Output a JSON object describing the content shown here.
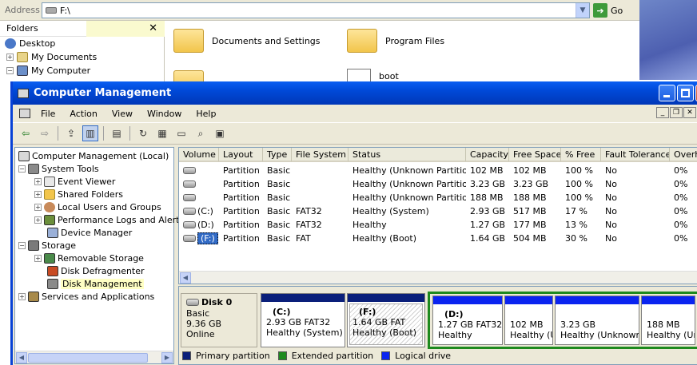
{
  "explorer": {
    "address_label": "Address",
    "address_value": "F:\\",
    "go_label": "Go",
    "folders_title": "Folders",
    "tree": [
      "Desktop",
      "My Documents",
      "My Computer"
    ],
    "files": [
      "Documents and Settings",
      "Program Files",
      "boot"
    ]
  },
  "window": {
    "title": "Computer Management",
    "menu": [
      "File",
      "Action",
      "View",
      "Window",
      "Help"
    ]
  },
  "tree": {
    "root": "Computer Management (Local)",
    "system_tools": "System Tools",
    "event_viewer": "Event Viewer",
    "shared_folders": "Shared Folders",
    "local_users": "Local Users and Groups",
    "perf_logs": "Performance Logs and Alerts",
    "device_manager": "Device Manager",
    "storage": "Storage",
    "removable_storage": "Removable Storage",
    "disk_defrag": "Disk Defragmenter",
    "disk_management": "Disk Management",
    "services_apps": "Services and Applications"
  },
  "volumes": {
    "columns": [
      "Volume",
      "Layout",
      "Type",
      "File System",
      "Status",
      "Capacity",
      "Free Space",
      "% Free",
      "Fault Tolerance",
      "Overhead"
    ],
    "columns_visible": [
      "Volume",
      "Layout",
      "Type",
      "File System",
      "Status",
      "Capacity",
      "Free Space",
      "% Free",
      "Fault Tolerance",
      "Overhe"
    ],
    "rows": [
      [
        "",
        "Partition",
        "Basic",
        "",
        "Healthy (Unknown Partition)",
        "102 MB",
        "102 MB",
        "100 %",
        "No",
        "0%"
      ],
      [
        "",
        "Partition",
        "Basic",
        "",
        "Healthy (Unknown Partition)",
        "3.23 GB",
        "3.23 GB",
        "100 %",
        "No",
        "0%"
      ],
      [
        "",
        "Partition",
        "Basic",
        "",
        "Healthy (Unknown Partition)",
        "188 MB",
        "188 MB",
        "100 %",
        "No",
        "0%"
      ],
      [
        "(C:)",
        "Partition",
        "Basic",
        "FAT32",
        "Healthy (System)",
        "2.93 GB",
        "517 MB",
        "17 %",
        "No",
        "0%"
      ],
      [
        "(D:)",
        "Partition",
        "Basic",
        "FAT32",
        "Healthy",
        "1.27 GB",
        "177 MB",
        "13 %",
        "No",
        "0%"
      ],
      [
        "(F:)",
        "Partition",
        "Basic",
        "FAT",
        "Healthy (Boot)",
        "1.64 GB",
        "504 MB",
        "30 %",
        "No",
        "0%"
      ]
    ]
  },
  "disk": {
    "name": "Disk 0",
    "type": "Basic",
    "size": "9.36 GB",
    "state": "Online",
    "partitions": [
      {
        "label": "(C:)",
        "size": "2.93 GB FAT32",
        "status": "Healthy (System)"
      },
      {
        "label": "(F:)",
        "size": "1.64 GB FAT",
        "status": "Healthy (Boot)"
      },
      {
        "label": "(D:)",
        "size": "1.27 GB FAT32",
        "status": "Healthy"
      },
      {
        "label": "",
        "size": "102 MB",
        "status": "Healthy (U"
      },
      {
        "label": "",
        "size": "3.23 GB",
        "status": "Healthy (Unknown P"
      },
      {
        "label": "",
        "size": "188 MB",
        "status": "Healthy (Un"
      }
    ]
  },
  "legend": [
    "Primary partition",
    "Extended partition",
    "Logical drive"
  ],
  "colors": {
    "primary": "#0a1f7a",
    "extended": "#1e8a1e",
    "logical": "#0a24f0",
    "title": "#0049d8"
  }
}
